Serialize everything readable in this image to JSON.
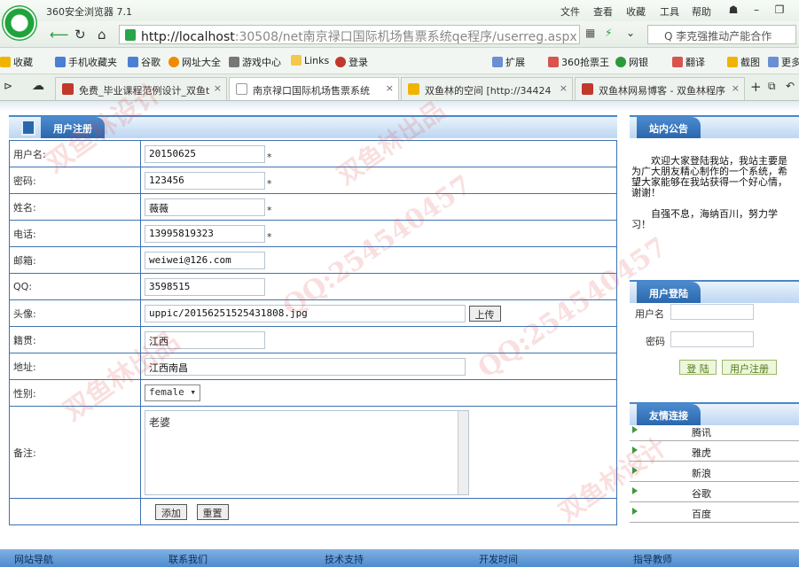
{
  "browser": {
    "title": "360安全浏览器 7.1",
    "menu": [
      "文件",
      "查看",
      "收藏",
      "工具",
      "帮助"
    ],
    "url_host": "http://localhost",
    "url_rest": ":30508/net南京禄口国际机场售票系统qe程序/userreg.aspx",
    "search_text": "Q 李克强推动产能合作",
    "favorites": [
      {
        "label": "收藏",
        "icon": "star-icon"
      },
      {
        "label": "手机收藏夹",
        "icon": "phone-icon"
      },
      {
        "label": "谷歌",
        "icon": "google-icon"
      },
      {
        "label": "网址大全",
        "icon": "globe-icon"
      },
      {
        "label": "游戏中心",
        "icon": "gamepad-icon"
      },
      {
        "label": "Links",
        "icon": "folder-icon"
      },
      {
        "label": "登录",
        "icon": "login-icon"
      },
      {
        "label": "扩展",
        "icon": "grid-icon"
      },
      {
        "label": "360抢票王",
        "icon": "ticket-icon"
      },
      {
        "label": "网银",
        "icon": "bank-icon"
      },
      {
        "label": "翻译",
        "icon": "translate-icon"
      },
      {
        "label": "截图",
        "icon": "scissors-icon"
      },
      {
        "label": "更多",
        "icon": "more-icon"
      }
    ],
    "tabs": [
      {
        "label": "免费_毕业课程范例设计_双鱼t",
        "active": false
      },
      {
        "label": "南京禄口国际机场售票系统",
        "active": true
      },
      {
        "label": "双鱼林的空间 [http://34424",
        "active": false
      },
      {
        "label": "双鱼林网易博客 - 双鱼林程序",
        "active": false
      }
    ]
  },
  "register": {
    "heading": "用户注册",
    "fields": [
      {
        "label": "用户名:",
        "value": "20150625",
        "required": true
      },
      {
        "label": "密码:",
        "value": "123456",
        "required": true
      },
      {
        "label": "姓名:",
        "value": "薇薇",
        "required": true
      },
      {
        "label": "电话:",
        "value": "13995819323",
        "required": true
      },
      {
        "label": "邮箱:",
        "value": "weiwei@126.com",
        "required": false
      },
      {
        "label": "QQ:",
        "value": "3598515",
        "required": false
      }
    ],
    "avatar_label": "头像:",
    "avatar_value": "uppic/20156251525431808.jpg",
    "upload_label": "上传",
    "origin_label": "籍贯:",
    "origin_value": "江西",
    "address_label": "地址:",
    "address_value": "江西南昌",
    "gender_label": "性别:",
    "gender_value": "female",
    "note_label": "备注:",
    "note_value": "老婆",
    "required_mark": "*",
    "add_label": "添加",
    "reset_label": "重置"
  },
  "sidebar": {
    "notice_title": "站内公告",
    "notice_p1": "欢迎大家登陆我站，我站主要是为广大朋友精心制作的一个系统，希望大家能够在我站获得一个好心情，谢谢！",
    "notice_p2": "自强不息，海纳百川，努力学习！",
    "login_title": "用户登陆",
    "username_label": "用户名",
    "password_label": "密码",
    "login_btn": "登 陆",
    "register_btn": "用户注册",
    "links_title": "友情连接",
    "links": [
      "腾讯",
      "雅虎",
      "新浪",
      "谷歌",
      "百度"
    ]
  },
  "footer": [
    "网站导航",
    "联系我们",
    "技术支持",
    "开发时间",
    "指导教师"
  ],
  "watermark": [
    "QQ:254540457",
    "双鱼林设计",
    "双鱼林出品"
  ]
}
